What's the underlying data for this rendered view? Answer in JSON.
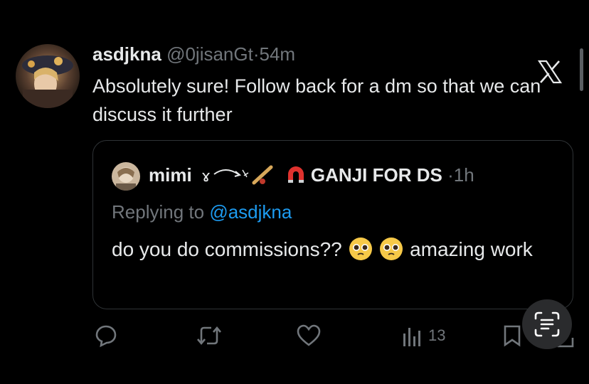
{
  "tweet": {
    "author_name": "asdjkna",
    "author_handle": "@0jisanGt",
    "separator": "·",
    "time": "54m",
    "text": "Absolutely sure! Follow back for a dm so that we can discuss it further"
  },
  "quoted": {
    "author_name": "mimi",
    "author_name_suffix": "GANJI FOR DS",
    "separator": "·",
    "time": "1h",
    "replying_prefix": "Replying to",
    "replying_to": "@asdjkna",
    "text_before_emojis": "do you do commissions??",
    "text_after_emojis": "amazing work"
  },
  "actions": {
    "views": "13"
  },
  "icons": {
    "brand": "x-logo-icon",
    "reply": "comment-icon",
    "retweet": "retweet-icon",
    "like": "heart-icon",
    "views": "views-chart-icon",
    "bookmark": "bookmark-icon",
    "share": "share-icon",
    "lens": "text-scan-icon",
    "emoji": "pleading-face-emoji"
  },
  "colors": {
    "background": "#000000",
    "text": "#e7e9ea",
    "muted": "#71767b",
    "link": "#1d9bf0",
    "border": "#2f3336"
  }
}
